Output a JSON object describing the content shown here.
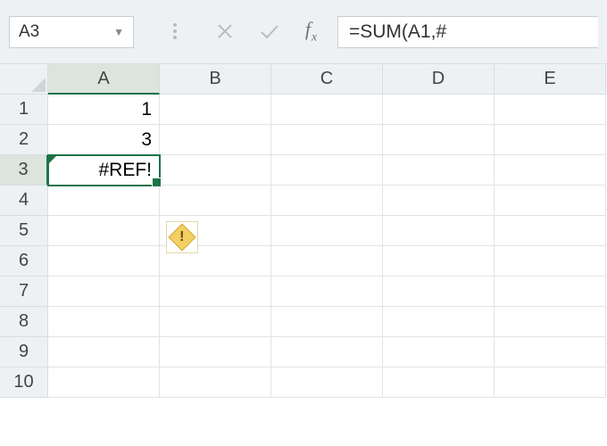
{
  "namebox": {
    "value": "A3"
  },
  "formula_bar": {
    "value": "=SUM(A1,#"
  },
  "columns": [
    "A",
    "B",
    "C",
    "D",
    "E"
  ],
  "selected_column_index": 0,
  "rows": [
    "1",
    "2",
    "3",
    "4",
    "5",
    "6",
    "7",
    "8",
    "9",
    "10"
  ],
  "selected_row_index": 2,
  "cells": {
    "A1": "1",
    "A2": "3",
    "A3": "#REF!"
  },
  "error_indicator": {
    "cell": "A3",
    "glyph": "!"
  }
}
